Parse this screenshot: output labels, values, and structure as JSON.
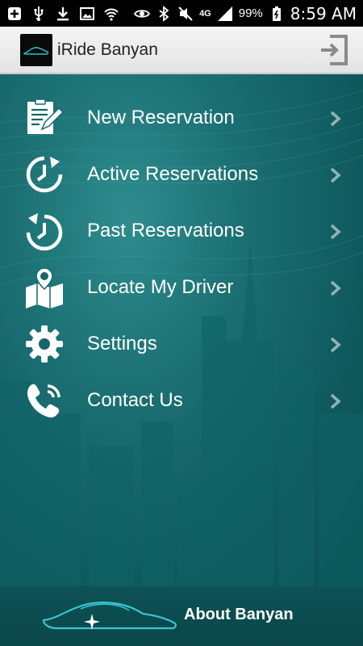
{
  "status_bar": {
    "battery": "99%",
    "time": "8:59 AM",
    "network": "4G",
    "icons": [
      "add-icon",
      "usb-icon",
      "download-icon",
      "image-icon",
      "wifi-shield-icon",
      "eye-icon",
      "bluetooth-icon",
      "mute-icon",
      "signal-icon",
      "battery-icon"
    ]
  },
  "header": {
    "title": "iRide Banyan",
    "logo": "car-logo-icon",
    "action_icon": "logout-icon"
  },
  "menu": {
    "items": [
      {
        "label": "New Reservation",
        "icon": "new-reservation-icon"
      },
      {
        "label": "Active Reservations",
        "icon": "clock-forward-icon"
      },
      {
        "label": "Past Reservations",
        "icon": "clock-back-icon"
      },
      {
        "label": "Locate My Driver",
        "icon": "map-pin-icon"
      },
      {
        "label": "Settings",
        "icon": "gear-icon"
      },
      {
        "label": "Contact Us",
        "icon": "phone-icon"
      }
    ],
    "chevron_icon": "chevron-right-icon"
  },
  "footer": {
    "label": "About Banyan",
    "icon": "car-outline-icon"
  },
  "colors": {
    "background_teal": "#1b6f72",
    "footer": "#0b4b4e",
    "header": "#ececec",
    "accent_cyan": "#37c6d0"
  }
}
